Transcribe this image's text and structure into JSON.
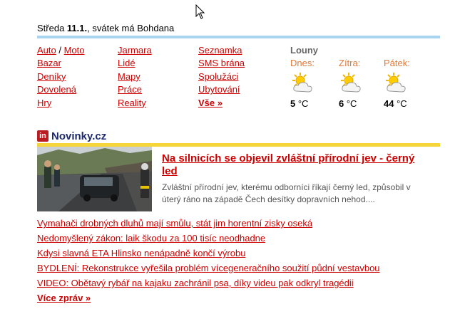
{
  "header": {
    "day_prefix": "Středa ",
    "date": "11.1.",
    "name_day": ", svátek má Bohdana"
  },
  "links": {
    "col1": {
      "auto": "Auto",
      "sep": " / ",
      "moto": "Moto",
      "items": [
        "Bazar",
        "Deníky",
        "Dovolená",
        "Hry"
      ]
    },
    "col2": [
      "Jarmara",
      "Lidé",
      "Mapy",
      "Práce",
      "Reality"
    ],
    "col3": [
      "Seznamka",
      "SMS brána",
      "Spolužáci",
      "Ubytování"
    ],
    "col3_more": "Vše »"
  },
  "weather": {
    "city": "Louny",
    "unit": " °C",
    "days": [
      {
        "name": "Dnes:",
        "temp": "5",
        "icon": "partly-cloudy-icon"
      },
      {
        "name": "Zítra:",
        "temp": "6",
        "icon": "partly-cloudy-icon"
      },
      {
        "name": "Pátek:",
        "temp": "44",
        "icon": "partly-cloudy-icon"
      }
    ]
  },
  "novinky": {
    "logo_text": "in",
    "title": "Novinky.cz",
    "main": {
      "headline": "Na silnicích se objevil zvláštní přírodní jev - černý led",
      "perex": "Zvláštní přírodní jev, kterému odborníci říkají černý led, způsobil v úterý ráno na západě Čech desítky dopravních nehod...."
    },
    "items": [
      "Vymahači drobných dluhů mají smůlu, stát jim horentní zisky oseká",
      "Nedomyšlený zákon: laik škodu za 100 tisíc neodhadne",
      "Kdysi slavná ETA Hlinsko nenápadně končí výrobu",
      "BYDLENÍ: Rekonstrukce vyřešila problém vícegeneračního soužití půdní vestavbou",
      "VIDEO: Obětavý rybář na kajaku zachránil psa, díky videu pak odkryl tragédii"
    ],
    "more": "Více zpráv »"
  },
  "colors": {
    "link": "#cc0000",
    "accent_blue_line": "#a9d4f0",
    "accent_yellow_line": "#f6d53a",
    "weather_day": "#e07a3c",
    "novinky_title": "#1e2a6e"
  }
}
